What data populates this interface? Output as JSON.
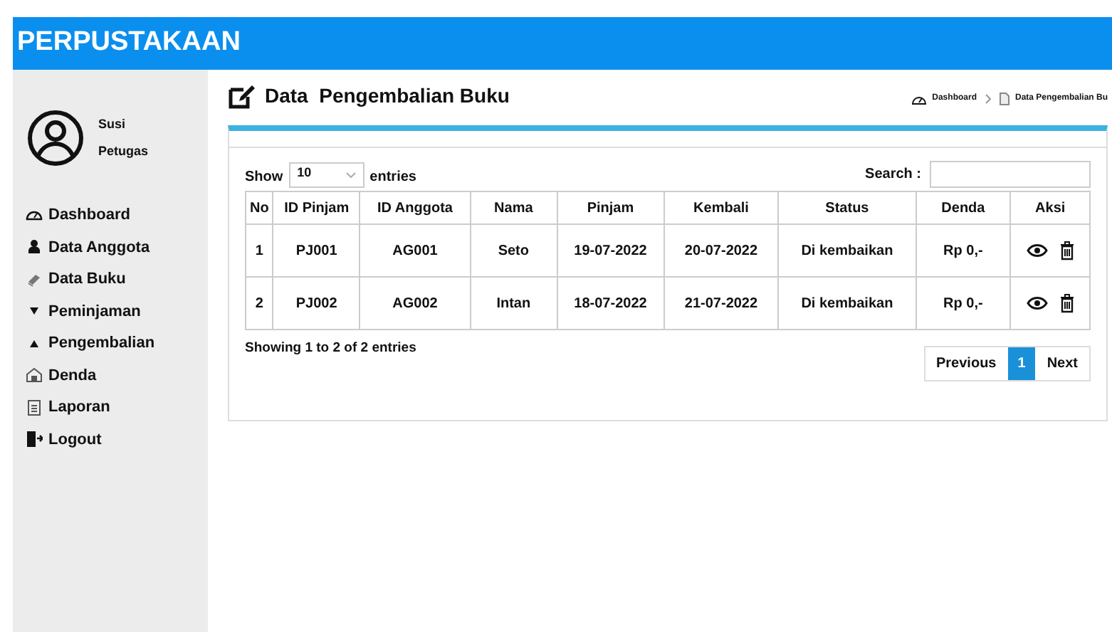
{
  "header": {
    "title": "PERPUSTAKAAN"
  },
  "user": {
    "name": "Susi",
    "role": "Petugas"
  },
  "sidebar": {
    "items": [
      {
        "label": "Dashboard"
      },
      {
        "label": "Data Anggota"
      },
      {
        "label": "Data Buku"
      },
      {
        "label": "Peminjaman"
      },
      {
        "label": "Pengembalian"
      },
      {
        "label": "Denda"
      },
      {
        "label": "Laporan"
      },
      {
        "label": "Logout"
      }
    ]
  },
  "page_title": "Data  Pengembalian Buku",
  "breadcrumb": [
    "Dashboard",
    "Data Pengembalian Bu"
  ],
  "show": {
    "before": "Show",
    "value": "10",
    "after": "entries"
  },
  "search": {
    "label": "Search :"
  },
  "table": {
    "columns": [
      "No",
      "ID Pinjam",
      "ID Anggota",
      "Nama",
      "Pinjam",
      "Kembali",
      "Status",
      "Denda",
      "Aksi"
    ],
    "rows": [
      [
        "1",
        "PJ001",
        "AG001",
        "Seto",
        "19-07-2022",
        "20-07-2022",
        "Di kembaikan",
        "Rp 0,-"
      ],
      [
        "2",
        "PJ002",
        "AG002",
        "Intan",
        "18-07-2022",
        "21-07-2022",
        "Di kembaikan",
        "Rp 0,-"
      ]
    ]
  },
  "info": "Showing 1 to 2 of 2 entries",
  "pagination": {
    "previous": "Previous",
    "pages": [
      {
        "label": "1",
        "selected": true
      }
    ],
    "next": "Next"
  }
}
